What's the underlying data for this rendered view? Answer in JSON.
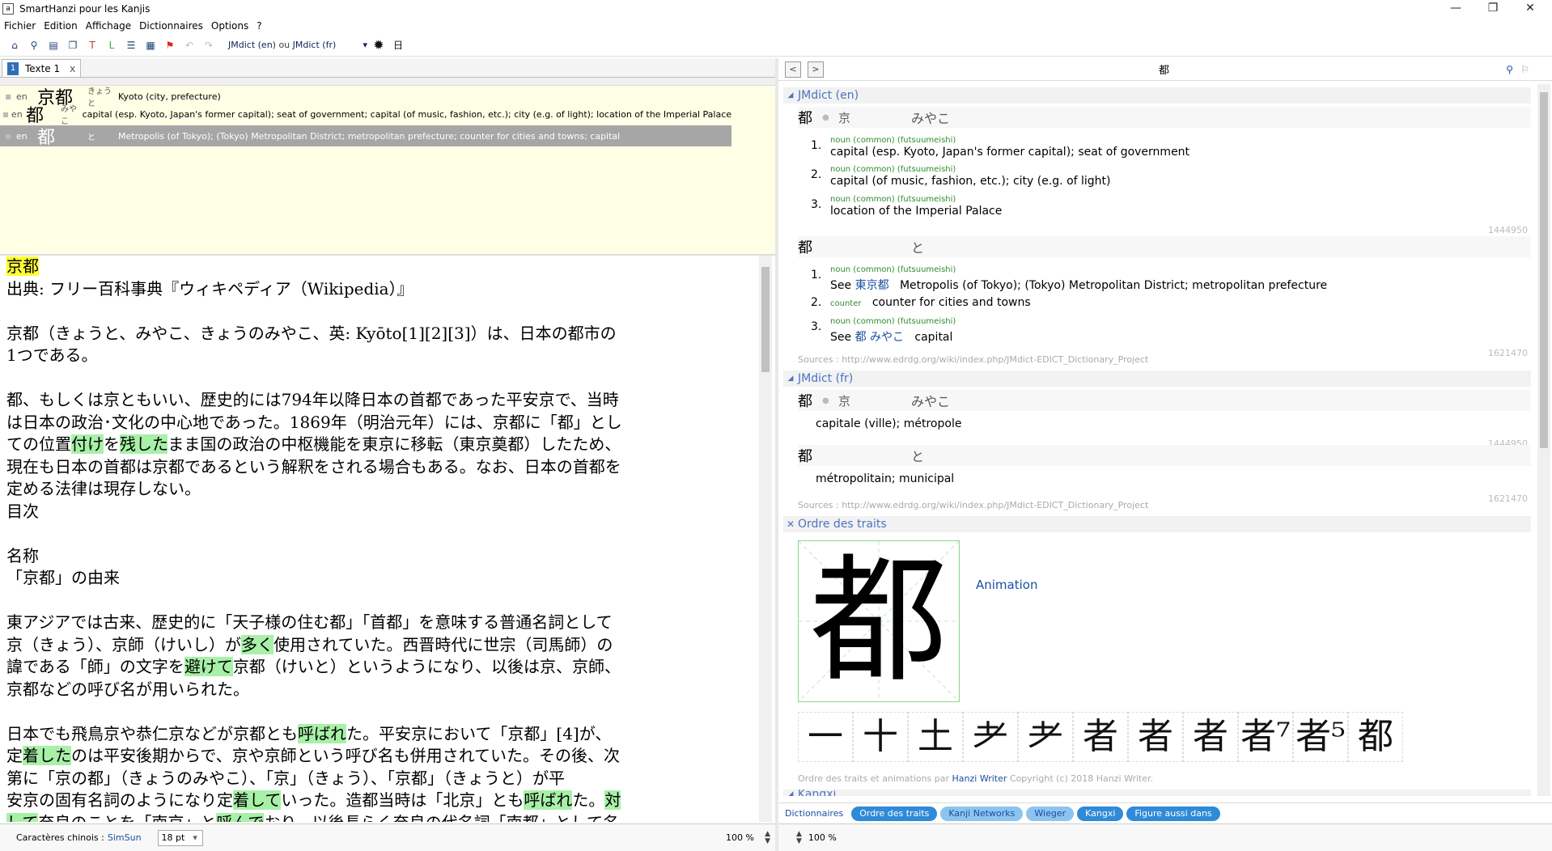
{
  "window": {
    "title": "SmartHanzi pour les Kanjis",
    "app_icon": "a",
    "controls": [
      "—",
      "❐",
      "✕"
    ]
  },
  "menu": [
    "Fichier",
    "Edition",
    "Affichage",
    "Dictionnaires",
    "Options",
    "?"
  ],
  "toolbar": {
    "dict_a": "JMdict (en)",
    "dict_ou": "ou",
    "dict_b": "JMdict (fr)",
    "day_char": "日"
  },
  "tab": {
    "num": "1",
    "label": "Texte 1",
    "close": "x"
  },
  "results": [
    {
      "lang": "en",
      "word": "京都",
      "kana": "きょうと",
      "def": "Kyoto (city, prefecture)",
      "selected": false
    },
    {
      "lang": "en",
      "word": "都",
      "kana": "みやこ",
      "def": "capital (esp. Kyoto, Japan's former capital); seat of government; capital (of music, fashion, etc.); city (e.g. of light); location of the Imperial Palace",
      "selected": false
    },
    {
      "lang": "en",
      "word": "都",
      "kana": "と",
      "def": "Metropolis (of Tokyo); (Tokyo) Metropolitan District; metropolitan prefecture; counter for cities and towns; capital",
      "selected": true
    }
  ],
  "text": {
    "l0": "京都",
    "l1": "出典: フリー百科事典『ウィキペディア（Wikipedia）』",
    "l3": "京都（きょうと、みやこ、きょうのみやこ、英: Kyōto[1][2][3]）は、日本の都市の",
    "l4": "1つである。",
    "l6": "都、もしくは京ともいい、歴史的には794年以降日本の首都であった平安京で、当時",
    "l7": "は日本の政治･文化の中心地であった。1869年（明治元年）には、京都に「都」とし",
    "l8a": "ての位置",
    "l8b": "付け",
    "l8c": "を",
    "l8d": "残した",
    "l8e": "まま国の政治の中枢機能を東京に移転（東京奠都）したため、",
    "l9": "現在も日本の首都は京都であるという解釈をされる場合もある。なお、日本の首都を",
    "l10": "定める法律は現存しない。",
    "l11": "目次",
    "l13": "名称",
    "l14": "「京都」の由来",
    "l16": "東アジアでは古来、歴史的に「天子様の住む都」「首都」を意味する普通名詞として",
    "l17a": "京（きょう）、京師（けいし）が",
    "l17b": "多く",
    "l17c": "使用されていた。西晋時代に世宗（司馬師）の",
    "l18a": "諱である「師」の文字を",
    "l18b": "避けて",
    "l18c": "京都（けいと）というようになり、以後は京、京師、",
    "l19": "京都などの呼び名が用いられた。",
    "l21a": "日本でも飛鳥京や恭仁京などが京都とも",
    "l21b": "呼ばれ",
    "l21c": "た。平安京において「京都」[4]が、",
    "l22a": "定",
    "l22b": "着した",
    "l22c": "のは平安後期からで、京や京師という呼び名も併用されていた。その後、次",
    "l23": "第に「京の都」（きょうのみやこ）、「京」（きょう）、「京都」（きょうと）が平",
    "l24a": "安京の固有名詞のようになり定",
    "l24b": "着して",
    "l24c": "いった。造都当時は「北京」とも",
    "l24d": "呼ばれ",
    "l24e": "た。",
    "l24f": "対",
    "l25a": "して",
    "l25b": "奈良のことを「南京」と",
    "l25c": "呼んで",
    "l25d": "おり、以後長らく奈良の代名詞「南都」として名"
  },
  "statusbar": {
    "label": "Caractères chinois :",
    "font": "SimSun",
    "size": "18 pt",
    "zoom": "100 %"
  },
  "right": {
    "query": "都",
    "jmdict_en": {
      "title": "JMdict (en)",
      "e1": {
        "kanji": "都",
        "alt": "京",
        "reading": "みやこ",
        "id": "1444950"
      },
      "e1_senses": [
        {
          "n": "1.",
          "pos": "noun (common) (futsuumeishi)",
          "gloss": "capital (esp. Kyoto, Japan's former capital); seat of government"
        },
        {
          "n": "2.",
          "pos": "noun (common) (futsuumeishi)",
          "gloss": "capital (of music, fashion, etc.); city (e.g. of light)"
        },
        {
          "n": "3.",
          "pos": "noun (common) (futsuumeishi)",
          "gloss": "location of the Imperial Palace"
        }
      ],
      "e2": {
        "kanji": "都",
        "reading": "と",
        "id": "1621470"
      },
      "e2_s1": {
        "n": "1.",
        "pos": "noun (common) (futsuumeishi)",
        "see": "See",
        "link": "東京都",
        "gloss": "Metropolis (of Tokyo); (Tokyo) Metropolitan District; metropolitan prefecture"
      },
      "e2_s2": {
        "n": "2.",
        "pos": "counter",
        "gloss": "counter for cities and towns"
      },
      "e2_s3": {
        "n": "3.",
        "pos": "noun (common) (futsuumeishi)",
        "see": "See",
        "link": "都 みやこ",
        "gloss": "capital"
      },
      "sources": "Sources : http://www.edrdg.org/wiki/index.php/JMdict-EDICT_Dictionary_Project"
    },
    "jmdict_fr": {
      "title": "JMdict (fr)",
      "e1": {
        "kanji": "都",
        "alt": "京",
        "reading": "みやこ",
        "gloss": "capitale (ville); métropole",
        "id": "1444950"
      },
      "e2": {
        "kanji": "都",
        "reading": "と",
        "gloss": "métropolitain; municipal",
        "id": "1621470"
      },
      "sources": "Sources : http://www.edrdg.org/wiki/index.php/JMdict-EDICT_Dictionary_Project"
    },
    "strokes": {
      "title": "Ordre des traits",
      "char": "都",
      "animation": "Animation",
      "steps": [
        "一",
        "十",
        "土",
        "耂",
        "耂",
        "者",
        "者",
        "者",
        "者⁷",
        "者⁵",
        "都"
      ],
      "credit_a": "Ordre des traits et animations par",
      "credit_link": "Hanzi Writer",
      "credit_b": "Copyright (c) 2018 Hanzi Writer."
    },
    "kangxi_title": "Kangxi",
    "dictionaries_label": "Dictionnaires",
    "pills": [
      "Ordre des traits",
      "Kanji Networks",
      "Wieger",
      "Kangxi",
      "Figure aussi dans"
    ],
    "zoom": "100 %"
  },
  "colors": {
    "accent": "#2f8ad8",
    "highlight_yellow": "#ffff33",
    "highlight_green": "#a8f0a8"
  }
}
